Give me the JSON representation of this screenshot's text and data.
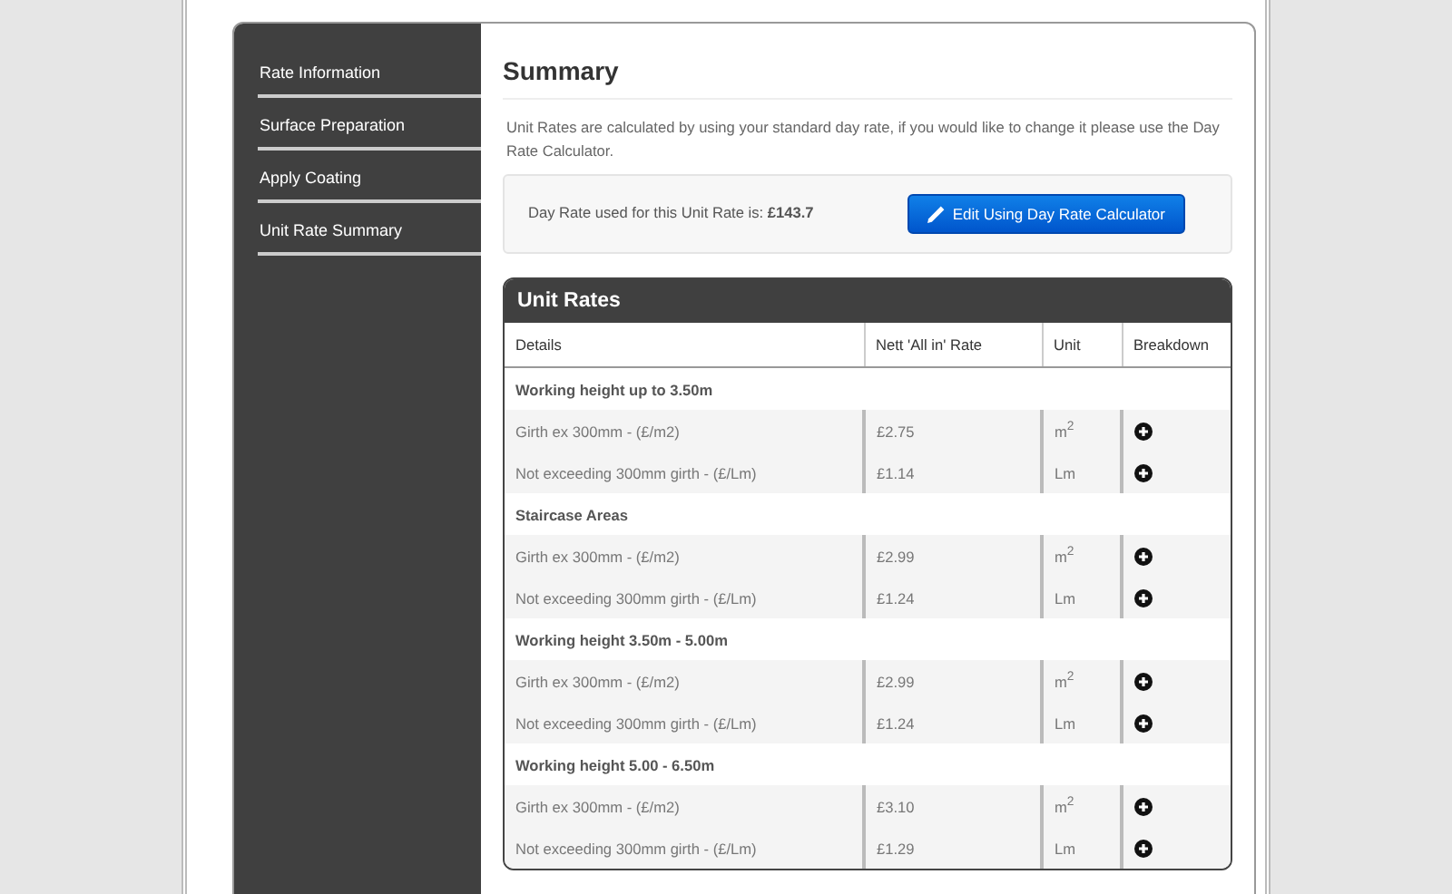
{
  "sidebar": {
    "items": [
      {
        "label": "Rate Information"
      },
      {
        "label": "Surface Preparation"
      },
      {
        "label": "Apply Coating"
      },
      {
        "label": "Unit Rate Summary"
      }
    ]
  },
  "summary": {
    "title": "Summary",
    "intro": "Unit Rates are calculated by using your standard day rate, if you would like to change it please use the Day Rate Calculator.",
    "day_rate_text": "Day Rate used for this Unit Rate is: **£143.7**",
    "edit_button": "Edit Using Day Rate Calculator"
  },
  "unit_rates": {
    "title": "Unit Rates",
    "columns": [
      "Details",
      "Nett 'All in' Rate",
      "Unit",
      "Breakdown"
    ],
    "groups": [
      {
        "heading": "Working height up to 3.50m",
        "rows": [
          {
            "details": "Girth ex 300mm - (£/m2)",
            "rate": "£2.75",
            "unit": "m$^{2}$"
          },
          {
            "details": "Not exceeding 300mm girth - (£/Lm)",
            "rate": "£1.14",
            "unit": "Lm"
          }
        ]
      },
      {
        "heading": "Staircase Areas",
        "rows": [
          {
            "details": "Girth ex 300mm - (£/m2)",
            "rate": "£2.99",
            "unit": "m$^{2}$"
          },
          {
            "details": "Not exceeding 300mm girth - (£/Lm)",
            "rate": "£1.24",
            "unit": "Lm"
          }
        ]
      },
      {
        "heading": "Working height 3.50m - 5.00m",
        "rows": [
          {
            "details": "Girth ex 300mm - (£/m2)",
            "rate": "£2.99",
            "unit": "m$^{2}$"
          },
          {
            "details": "Not exceeding 300mm girth - (£/Lm)",
            "rate": "£1.24",
            "unit": "Lm"
          }
        ]
      },
      {
        "heading": "Working height 5.00 - 6.50m",
        "rows": [
          {
            "details": "Girth ex 300mm - (£/m2)",
            "rate": "£3.10",
            "unit": "m$^{2}$"
          },
          {
            "details": "Not exceeding 300mm girth - (£/Lm)",
            "rate": "£1.29",
            "unit": "Lm"
          }
        ]
      }
    ]
  }
}
